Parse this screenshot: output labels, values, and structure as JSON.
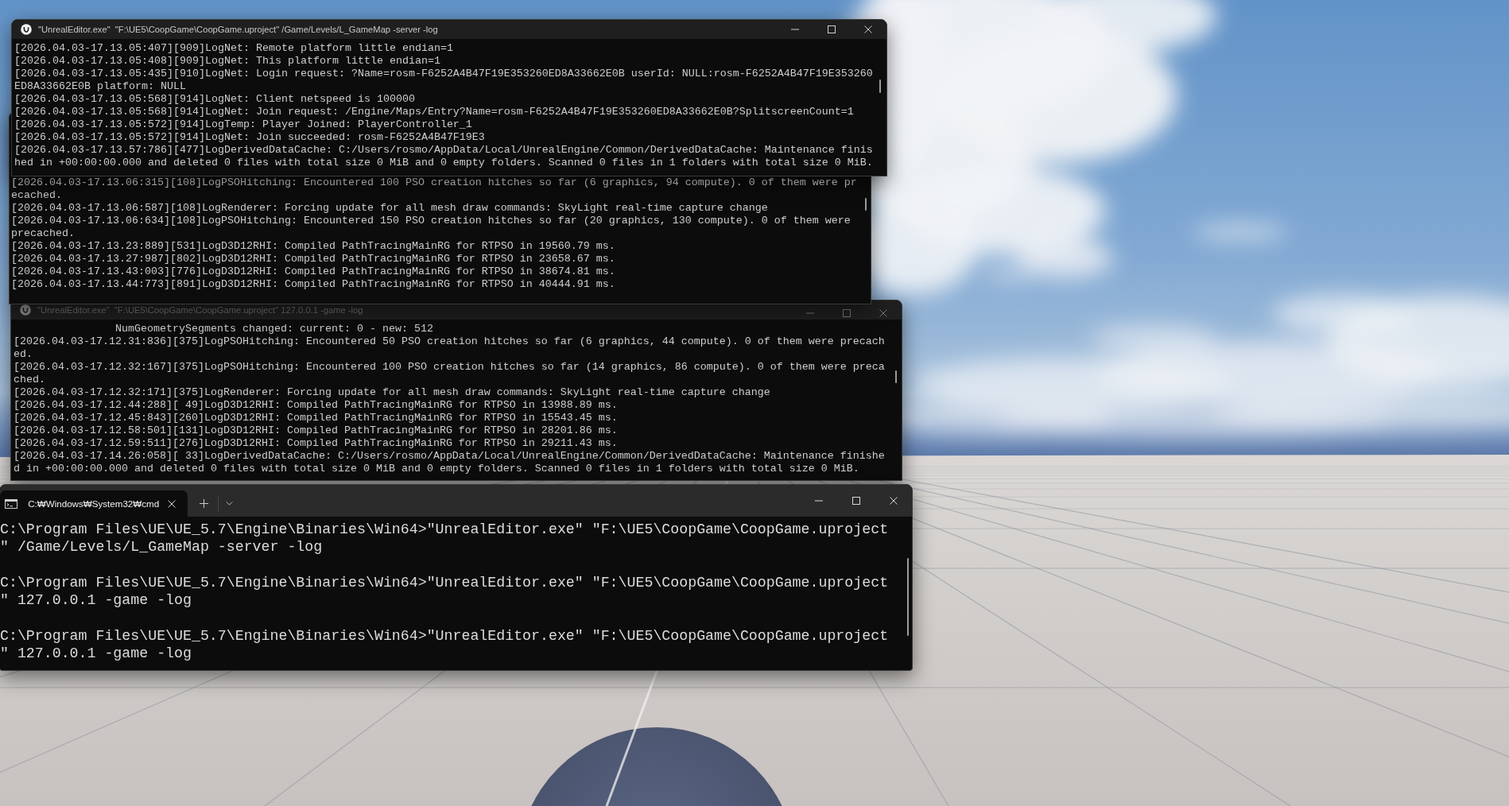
{
  "windows": [
    {
      "kind": "console",
      "title": "\"UnrealEditor.exe\"  \"F:\\UE5\\CoopGame\\CoopGame.uproject\" /Game/Levels/L_GameMap -server -log",
      "active": true,
      "lines": [
        "[2026.04.03-17.13.05:407][909]LogNet: Remote platform little endian=1",
        "[2026.04.03-17.13.05:408][909]LogNet: This platform little endian=1",
        "[2026.04.03-17.13.05:435][910]LogNet: Login request: ?Name=rosm-F6252A4B47F19E353260ED8A33662E0B userId: NULL:rosm-F6252A4B47F19E353260ED8A33662E0B platform: NULL",
        "[2026.04.03-17.13.05:568][914]LogNet: Client netspeed is 100000",
        "[2026.04.03-17.13.05:568][914]LogNet: Join request: /Engine/Maps/Entry?Name=rosm-F6252A4B47F19E353260ED8A33662E0B?SplitscreenCount=1",
        "[2026.04.03-17.13.05:572][914]LogTemp: Player Joined: PlayerController_1",
        "[2026.04.03-17.13.05:572][914]LogNet: Join succeeded: rosm-F6252A4B47F19E3",
        "[2026.04.03-17.13.57:786][477]LogDerivedDataCache: C:/Users/rosmo/AppData/Local/UnrealEngine/Common/DerivedDataCache: Maintenance finished in +00:00:00.000 and deleted 0 files with total size 0 MiB and 0 empty folders. Scanned 0 files in 1 folders with total size 0 MiB."
      ]
    },
    {
      "kind": "console",
      "lines": [
        "[2026.04.03-17.13.06:315][108]LogPSOHitching: Encountered 100 PSO creation hitches so far (6 graphics, 94 compute). 0 of them were precached.",
        "[2026.04.03-17.13.06:587][108]LogRenderer: Forcing update for all mesh draw commands: SkyLight real-time capture change",
        "[2026.04.03-17.13.06:634][108]LogPSOHitching: Encountered 150 PSO creation hitches so far (20 graphics, 130 compute). 0 of them were precached.",
        "[2026.04.03-17.13.23:889][531]LogD3D12RHI: Compiled PathTracingMainRG for RTPSO in 19560.79 ms.",
        "[2026.04.03-17.13.27:987][802]LogD3D12RHI: Compiled PathTracingMainRG for RTPSO in 23658.67 ms.",
        "[2026.04.03-17.13.43:003][776]LogD3D12RHI: Compiled PathTracingMainRG for RTPSO in 38674.81 ms.",
        "[2026.04.03-17.13.44:773][891]LogD3D12RHI: Compiled PathTracingMainRG for RTPSO in 40444.91 ms."
      ]
    },
    {
      "kind": "console",
      "title": "\"UnrealEditor.exe\"  \"F:\\UE5\\CoopGame\\CoopGame.uproject\" 127.0.0.1 -game -log",
      "active": false,
      "lines": [
        "                NumGeometrySegments changed: current: 0 - new: 512",
        "[2026.04.03-17.12.31:836][375]LogPSOHitching: Encountered 50 PSO creation hitches so far (6 graphics, 44 compute). 0 of them were precached.",
        "[2026.04.03-17.12.32:167][375]LogPSOHitching: Encountered 100 PSO creation hitches so far (14 graphics, 86 compute). 0 of them were precached.",
        "[2026.04.03-17.12.32:171][375]LogRenderer: Forcing update for all mesh draw commands: SkyLight real-time capture change",
        "[2026.04.03-17.12.44:288][ 49]LogD3D12RHI: Compiled PathTracingMainRG for RTPSO in 13988.89 ms.",
        "[2026.04.03-17.12.45:843][260]LogD3D12RHI: Compiled PathTracingMainRG for RTPSO in 15543.45 ms.",
        "[2026.04.03-17.12.58:501][131]LogD3D12RHI: Compiled PathTracingMainRG for RTPSO in 28201.86 ms.",
        "[2026.04.03-17.12.59:511][276]LogD3D12RHI: Compiled PathTracingMainRG for RTPSO in 29211.43 ms.",
        "[2026.04.03-17.14.26:058][ 33]LogDerivedDataCache: C:/Users/rosmo/AppData/Local/UnrealEngine/Common/DerivedDataCache: Maintenance finished in +00:00:00.000 and deleted 0 files with total size 0 MiB and 0 empty folders. Scanned 0 files in 1 folders with total size 0 MiB."
      ]
    },
    {
      "kind": "terminal",
      "tab": {
        "label": "C:₩Windows₩System32₩cmd",
        "selected": true
      },
      "lines": [
        "C:\\Program Files\\UE\\UE_5.7\\Engine\\Binaries\\Win64>\"UnrealEditor.exe\" \"F:\\UE5\\CoopGame\\CoopGame.uproject\" /Game/Levels/L_GameMap -server -log",
        "C:\\Program Files\\UE\\UE_5.7\\Engine\\Binaries\\Win64>\"UnrealEditor.exe\" \"F:\\UE5\\CoopGame\\CoopGame.uproject\" 127.0.0.1 -game -log",
        "C:\\Program Files\\UE\\UE_5.7\\Engine\\Binaries\\Win64>\"UnrealEditor.exe\" \"F:\\UE5\\CoopGame\\CoopGame.uproject\" 127.0.0.1 -game -log"
      ]
    }
  ]
}
